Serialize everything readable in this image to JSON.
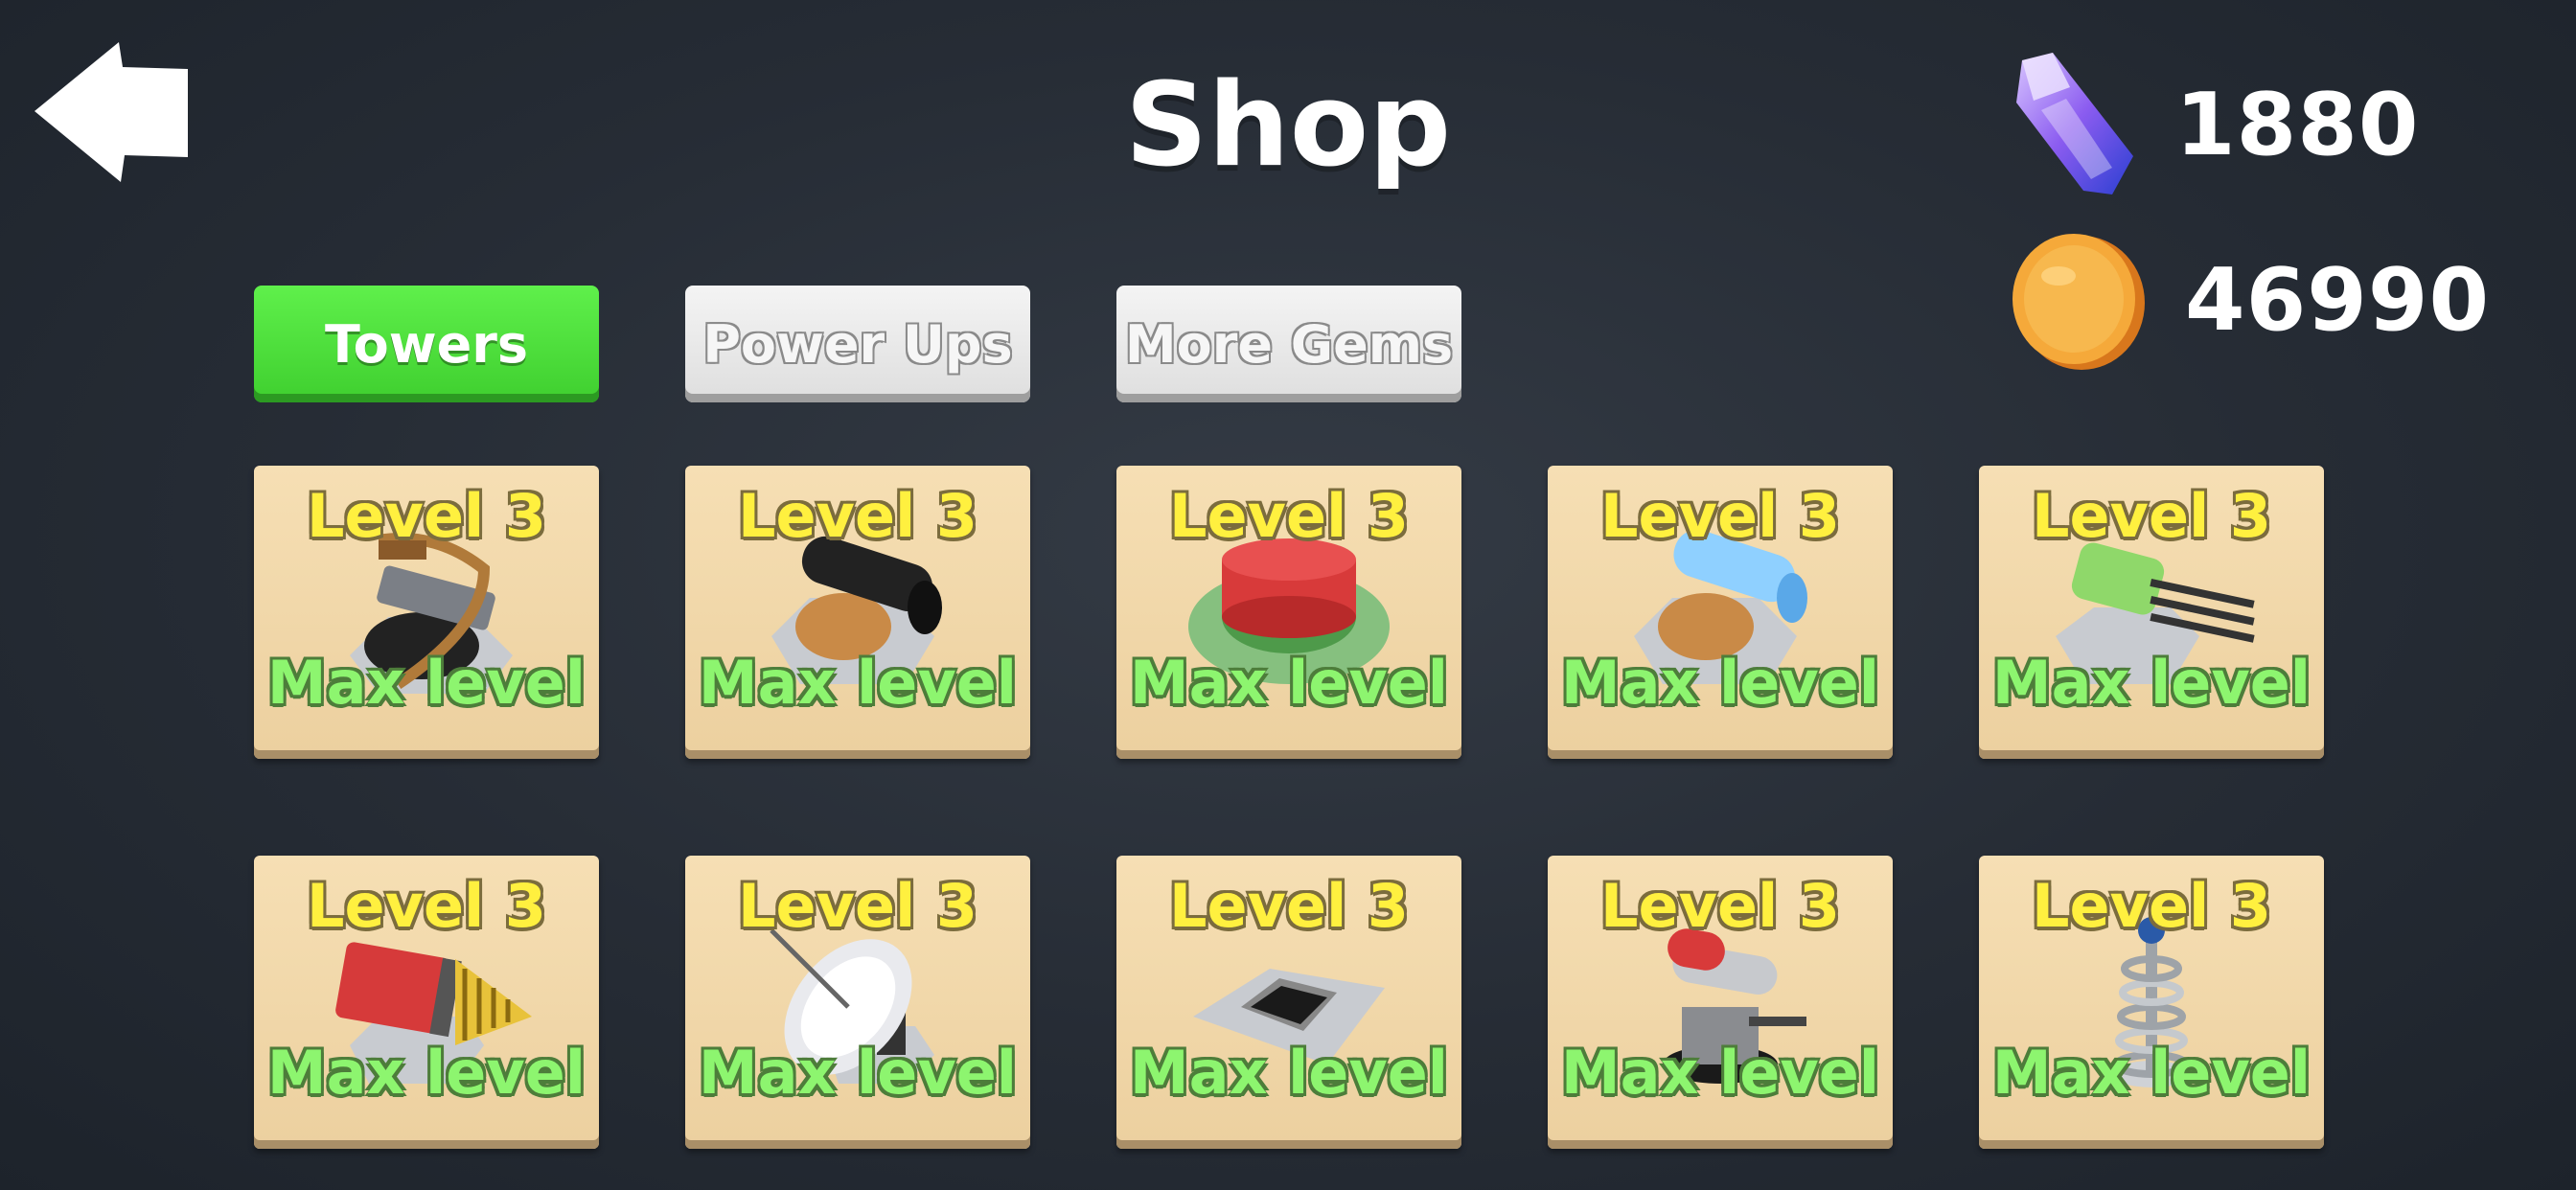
{
  "header": {
    "title": "Shop"
  },
  "currency": {
    "gems": {
      "icon": "gem-icon",
      "value": "1880"
    },
    "coins": {
      "icon": "coin-icon",
      "value": "46990"
    }
  },
  "tabs": [
    {
      "label": "Towers",
      "active": true
    },
    {
      "label": "Power Ups",
      "active": false
    },
    {
      "label": "More Gems",
      "active": false
    }
  ],
  "towers": [
    {
      "icon": "crossbow-tower-icon",
      "level": "Level 3",
      "status": "Max level"
    },
    {
      "icon": "cannon-tower-icon",
      "level": "Level 3",
      "status": "Max level"
    },
    {
      "icon": "button-trap-icon",
      "level": "Level 3",
      "status": "Max level"
    },
    {
      "icon": "ice-cannon-tower-icon",
      "level": "Level 3",
      "status": "Max level"
    },
    {
      "icon": "minigun-tower-icon",
      "level": "Level 3",
      "status": "Max level"
    },
    {
      "icon": "drill-tower-icon",
      "level": "Level 3",
      "status": "Max level"
    },
    {
      "icon": "radar-dish-tower-icon",
      "level": "Level 3",
      "status": "Max level"
    },
    {
      "icon": "pit-trap-icon",
      "level": "Level 3",
      "status": "Max level"
    },
    {
      "icon": "rocket-turret-icon",
      "level": "Level 3",
      "status": "Max level"
    },
    {
      "icon": "tesla-coil-tower-icon",
      "level": "Level 3",
      "status": "Max level"
    }
  ],
  "colors": {
    "active_tab": "#4ddf3c",
    "inactive_tab": "#e8e8e8",
    "card": "#f2d9aa",
    "level_text": "#fff03f",
    "max_level_text": "#8df56f"
  }
}
